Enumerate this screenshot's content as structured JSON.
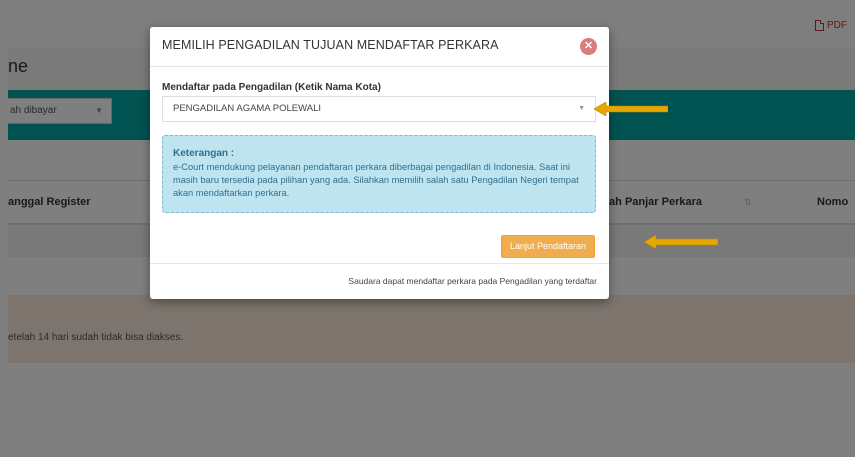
{
  "toolbar": {
    "pdf_label": "PDF",
    "pdf_icon": "pdf-icon"
  },
  "page": {
    "title_fragment": "ne",
    "status_filter": "ah dibayar",
    "table": {
      "headers": [
        "anggal Register",
        "lah Panjar Perkara",
        "Nomo"
      ]
    },
    "notice_fragment": "etelah 14 hari sudah tidak bisa diakses."
  },
  "modal": {
    "title": "MEMILIH PENGADILAN TUJUAN MENDAFTAR PERKARA",
    "close_icon": "close-icon",
    "field_label": "Mendaftar pada Pengadilan (Ketik Nama Kota)",
    "selected_court": "PENGADILAN AGAMA POLEWALI",
    "info_title": "Keterangan :",
    "info_text": "e-Court mendukung pelayanan pendaftaran perkara diberbagai pengadilan di Indonesia. Saat ini masih baru tersedia pada pilihan yang ada. Silahkan memilih salah satu Pengadilan Negeri tempat akan mendaftarkan perkara.",
    "next_button": "Lanjut Pendaftaran",
    "footer_note": "Saudara dapat mendaftar perkara pada Pengadilan yang terdaftar"
  },
  "colors": {
    "accent_teal": "#00a7a0",
    "button_orange": "#f0ad4e",
    "info_bg": "#bde4ef",
    "annotation_arrow": "#e6a800"
  }
}
